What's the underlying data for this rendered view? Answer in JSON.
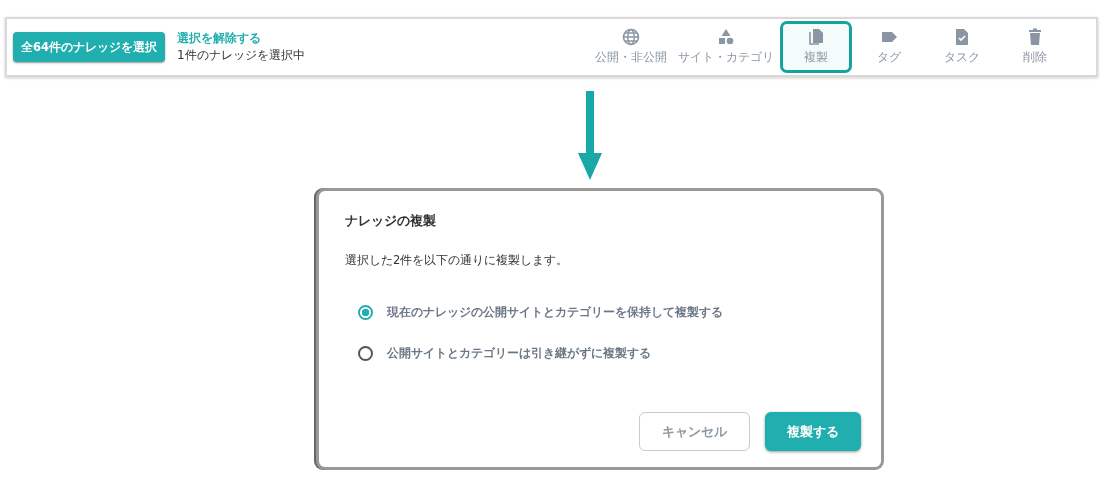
{
  "toolbar": {
    "select_all_button": "全64件のナレッジを選択",
    "deselect_link": "選択を解除する",
    "selection_count": "1件のナレッジを選択中",
    "tools": [
      {
        "label": "公開・非公開",
        "selected": false
      },
      {
        "label": "サイト・カテゴリ",
        "selected": false
      },
      {
        "label": "複製",
        "selected": true
      },
      {
        "label": "タグ",
        "selected": false
      },
      {
        "label": "タスク",
        "selected": false
      },
      {
        "label": "削除",
        "selected": false
      }
    ]
  },
  "dialog": {
    "title": "ナレッジの複製",
    "message": "選択した2件を以下の通りに複製します。",
    "options": [
      {
        "label": "現在のナレッジの公開サイトとカテゴリーを保持して複製する",
        "selected": true
      },
      {
        "label": "公開サイトとカテゴリーは引き継がずに複製する",
        "selected": false
      }
    ],
    "buttons": [
      {
        "label": "キャンセル",
        "kind": "secondary"
      },
      {
        "label": "複製する",
        "kind": "primary"
      }
    ]
  }
}
